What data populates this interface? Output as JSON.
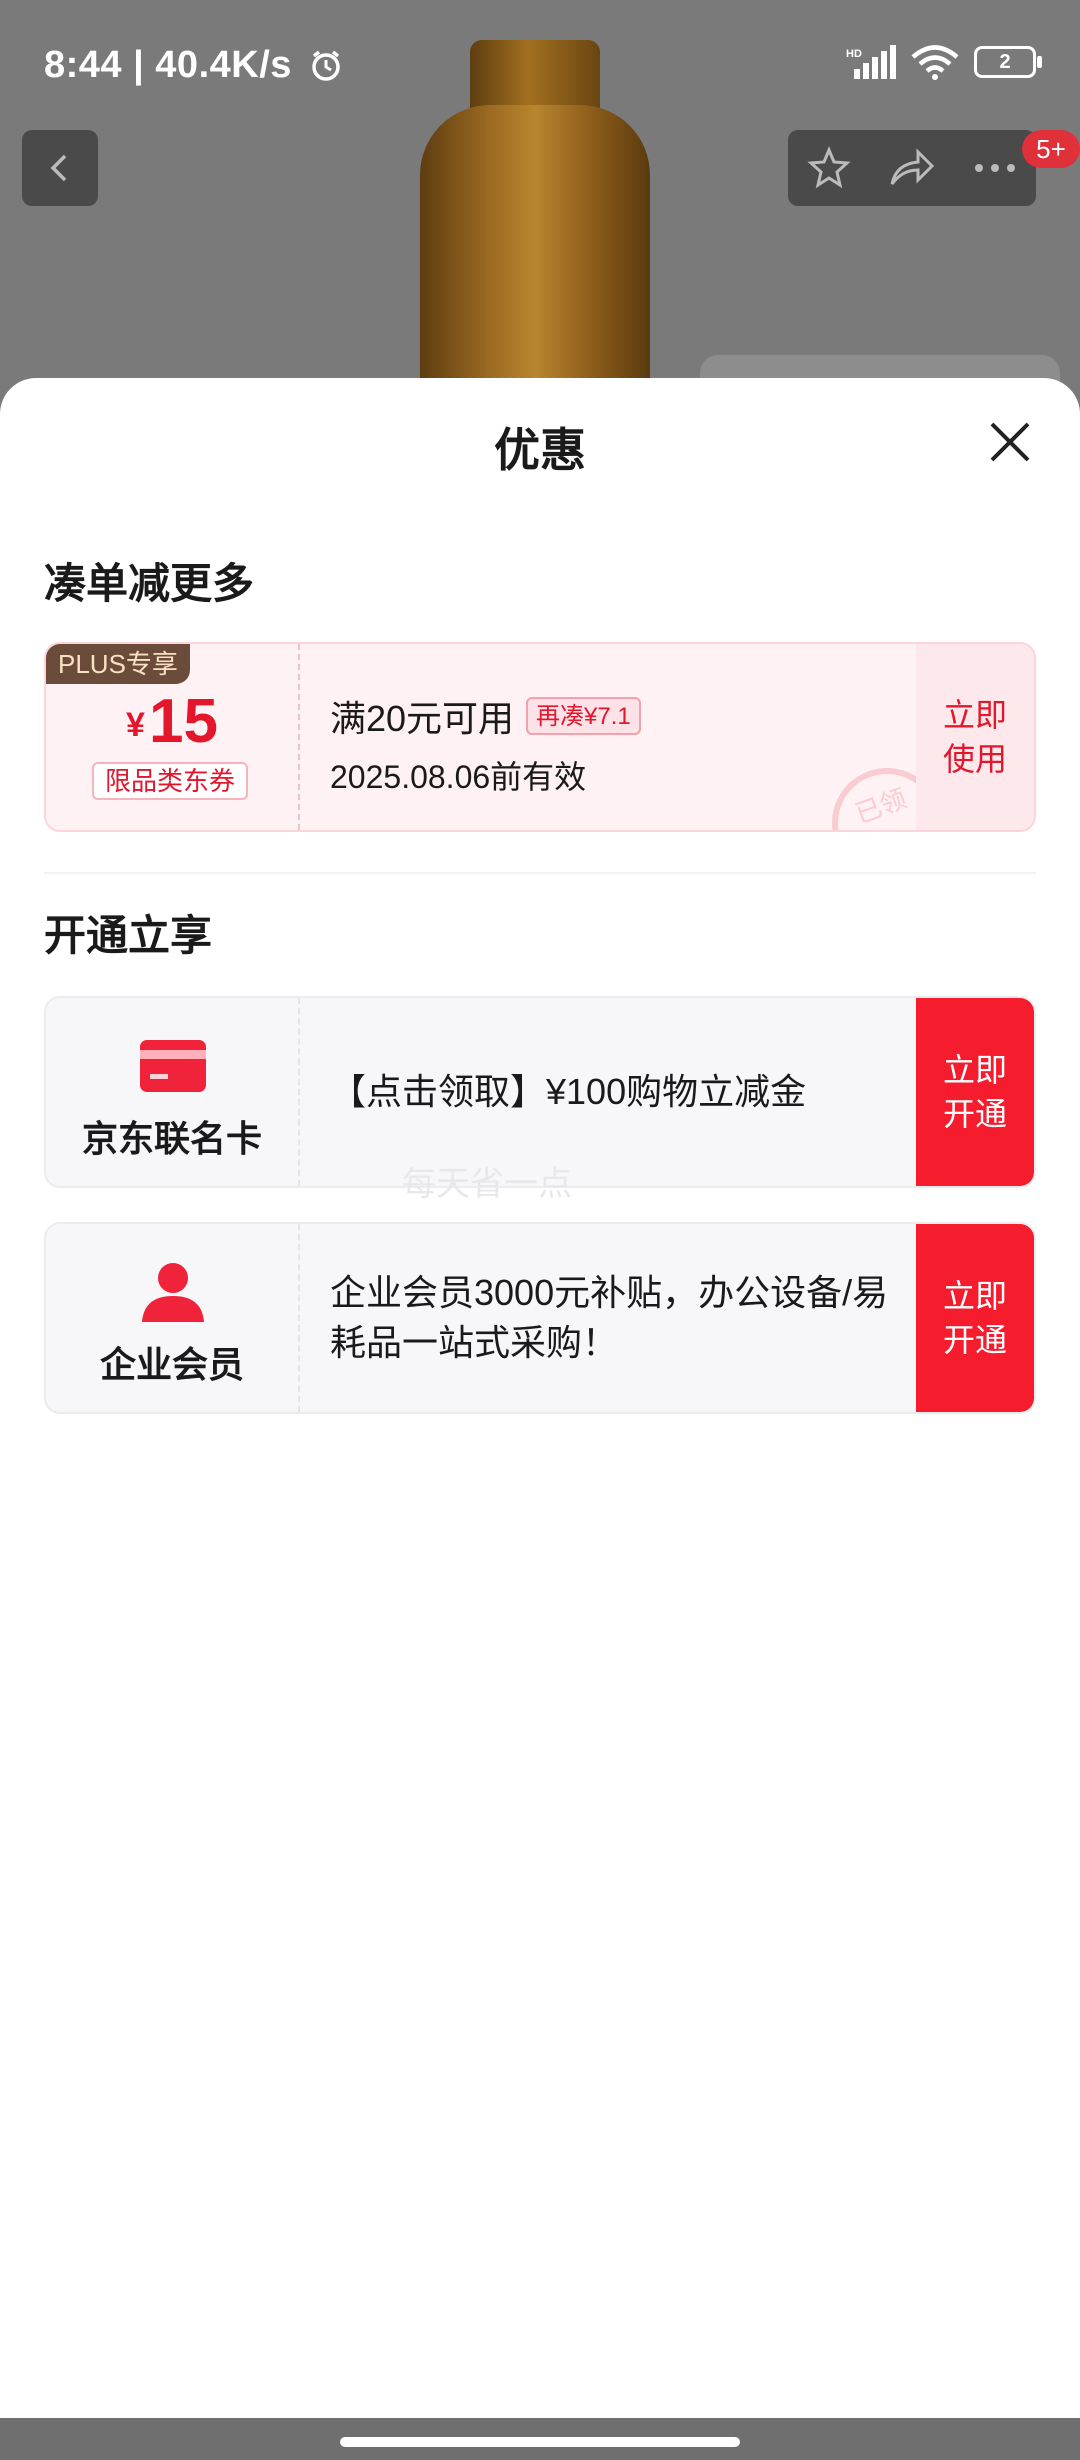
{
  "status_bar": {
    "time": "8:44 | 40.4K/s",
    "battery": "2",
    "icons": [
      "alarm-icon",
      "signal-icon",
      "wifi-icon",
      "battery-icon"
    ]
  },
  "top_nav": {
    "cart_badge": "5+",
    "icons": [
      "back-icon",
      "star-icon",
      "share-icon",
      "more-icon"
    ]
  },
  "sheet": {
    "title": "优惠",
    "close_icon": "close-icon",
    "section_coupons": "凑单减更多",
    "coupon": {
      "tag": "PLUS专享",
      "currency": "¥",
      "amount": "15",
      "type_label": "限品类东券",
      "condition": "满20元可用",
      "add_more": "再凑¥7.1",
      "valid_until": "2025.08.06前有效",
      "action": "立即使用",
      "stamp": "已领"
    },
    "section_benefits": "开通立享",
    "benefits": [
      {
        "name": "京东联名卡",
        "icon": "card-icon",
        "description": "【点击领取】¥100购物立减金",
        "action": "立即开通"
      },
      {
        "name": "企业会员",
        "icon": "user-icon",
        "description": "企业会员3000元补贴，办公设备/易耗品一站式采购！",
        "action": "立即开通"
      }
    ],
    "watermark": "每天省一点"
  },
  "colors": {
    "accent_red": "#f51c2e",
    "coupon_bg": "#fff2f4",
    "plus_tag_bg": "#6b4c3a"
  }
}
